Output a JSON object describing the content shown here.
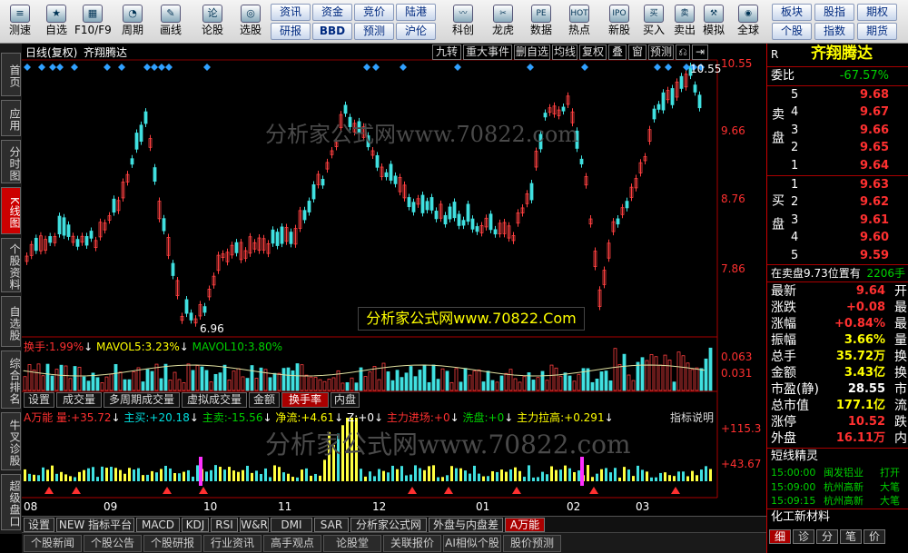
{
  "toolbar": {
    "tools": [
      {
        "label": "测速",
        "icon": "≡"
      },
      {
        "label": "自选",
        "icon": "★"
      },
      {
        "label": "F10/F9",
        "icon": "▦"
      },
      {
        "label": "周期",
        "icon": "◔"
      },
      {
        "label": "画线",
        "icon": "✎"
      },
      {
        "label": "论股",
        "icon": "论"
      },
      {
        "label": "选股",
        "icon": "◎"
      }
    ],
    "pills_row1": [
      "资讯",
      "资金",
      "竞价",
      "陆港"
    ],
    "pills_row2": [
      "研报",
      "BBD",
      "预测",
      "沪伦"
    ],
    "tools2": [
      {
        "label": "科创",
        "icon": "〰"
      },
      {
        "label": "龙虎",
        "icon": "✂"
      },
      {
        "label": "数据",
        "icon": "PE"
      },
      {
        "label": "热点",
        "icon": "HOT"
      },
      {
        "label": "新股",
        "icon": "IPO"
      },
      {
        "label": "买入",
        "icon": "买"
      },
      {
        "label": "卖出",
        "icon": "卖"
      },
      {
        "label": "模拟",
        "icon": "⚒"
      },
      {
        "label": "全球",
        "icon": "◉"
      }
    ],
    "pills_right_row1": [
      "板块",
      "股指",
      "期权"
    ],
    "pills_right_row2": [
      "个股",
      "指数",
      "期货"
    ]
  },
  "left_tabs": [
    "首页",
    "应用",
    "分时图",
    "K线图",
    "个股资料",
    "自选股",
    "综合排名",
    "牛叉诊股",
    "超级盘口"
  ],
  "left_active": 3,
  "chart_header": {
    "title": "日线(复权)",
    "stock": "齐翔腾达",
    "buttons": [
      "九转",
      "重大事件",
      "删自选",
      "均线",
      "复权",
      "叠",
      "窗",
      "预测",
      "⎌",
      "⇥"
    ]
  },
  "price_axis": [
    "10.55",
    "9.66",
    "8.76",
    "7.86"
  ],
  "price_labels": {
    "high": "10.55",
    "low": "6.96"
  },
  "indicator1": {
    "label": "换手:",
    "value": "1.99%",
    "mavol5_label": "MAVOL5:",
    "mavol5": "3.23%",
    "mavol10_label": "MAVOL10:",
    "mavol10": "3.80%",
    "axis": [
      "0.063",
      "0.031"
    ]
  },
  "subtabs": [
    "设置",
    "成交量",
    "多周期成交量",
    "虚拟成交量",
    "金额",
    "换手率",
    "内盘"
  ],
  "subtab_active": 5,
  "indicator2": {
    "text": [
      {
        "t": "A万能 量:",
        "v": "+35.72",
        "c": "red"
      },
      {
        "t": "主买:",
        "v": "+20.18",
        "c": "cyan"
      },
      {
        "t": "主卖:",
        "v": "-15.56",
        "c": "green"
      },
      {
        "t": "净流:",
        "v": "+4.61",
        "c": "yellow"
      },
      {
        "t": "Z:",
        "v": "+0",
        "c": "white"
      },
      {
        "t": "主力进场:",
        "v": "+0",
        "c": "red"
      },
      {
        "t": "洗盘:",
        "v": "+0",
        "c": "green"
      },
      {
        "t": "主力拉高:",
        "v": "+0.291",
        "c": "yellow"
      }
    ],
    "help": "指标说明",
    "axis": [
      "+115.3",
      "+43.67"
    ]
  },
  "x_axis_months": [
    "08",
    "09",
    "10",
    "11",
    "12",
    "01",
    "02",
    "03"
  ],
  "bottom_tabs": [
    "设置",
    "NEW 指标平台",
    "MACD",
    "KDJ",
    "RSI",
    "W&R",
    "DMI",
    "SAR",
    "分析家公式网",
    "外盘与内盘差",
    "A万能"
  ],
  "bottom_active": 10,
  "news_tabs": [
    "个股新闻",
    "个股公告",
    "个股研报",
    "行业资讯",
    "高手观点",
    "论股堂",
    "关联报价",
    "AI相似个股",
    "股价预测"
  ],
  "watermark": "分析家公式网www.70822.Com",
  "watermark_faint": "分析家公式网www.70822.com",
  "right": {
    "marker": "R",
    "stock": "齐翔腾达",
    "weibi_label": "委比",
    "weibi": "-67.57%",
    "sell_label": "卖盘",
    "sells": [
      {
        "n": "5",
        "p": "9.68"
      },
      {
        "n": "4",
        "p": "9.67"
      },
      {
        "n": "3",
        "p": "9.66"
      },
      {
        "n": "2",
        "p": "9.65"
      },
      {
        "n": "1",
        "p": "9.64"
      }
    ],
    "buy_label": "买盘",
    "buys": [
      {
        "n": "1",
        "p": "9.63"
      },
      {
        "n": "2",
        "p": "9.62"
      },
      {
        "n": "3",
        "p": "9.61"
      },
      {
        "n": "4",
        "p": "9.60"
      },
      {
        "n": "5",
        "p": "9.59"
      }
    ],
    "sell_note": "在卖盘9.73位置有",
    "sell_note_val": "2206手",
    "quotes": [
      {
        "k": "最新",
        "v": "9.64",
        "c": "red",
        "x": "开"
      },
      {
        "k": "涨跌",
        "v": "+0.08",
        "c": "red",
        "x": "最"
      },
      {
        "k": "涨幅",
        "v": "+0.84%",
        "c": "red",
        "x": "最"
      },
      {
        "k": "振幅",
        "v": "3.66%",
        "c": "yellow",
        "x": "量"
      },
      {
        "k": "总手",
        "v": "35.72万",
        "c": "yellow",
        "x": "换"
      },
      {
        "k": "金额",
        "v": "3.43亿",
        "c": "yellow",
        "x": "换"
      },
      {
        "k": "市盈(静)",
        "v": "28.55",
        "c": "white",
        "x": "市"
      },
      {
        "k": "总市值",
        "v": "177.1亿",
        "c": "yellow",
        "x": "流"
      },
      {
        "k": "涨停",
        "v": "10.52",
        "c": "red",
        "x": "跌"
      },
      {
        "k": "外盘",
        "v": "16.11万",
        "c": "red",
        "x": "内"
      }
    ],
    "short_title": "短线精灵",
    "short_rows": [
      {
        "time": "15:00:00",
        "name": "闽发铝业",
        "act": "打开"
      },
      {
        "time": "15:09:00",
        "name": "杭州高新",
        "act": "大笔"
      },
      {
        "time": "15:09:15",
        "name": "杭州高新",
        "act": "大笔"
      }
    ],
    "footer": "化工新材料",
    "footer_tabs": [
      "细",
      "诊",
      "分",
      "笔",
      "价"
    ]
  }
}
